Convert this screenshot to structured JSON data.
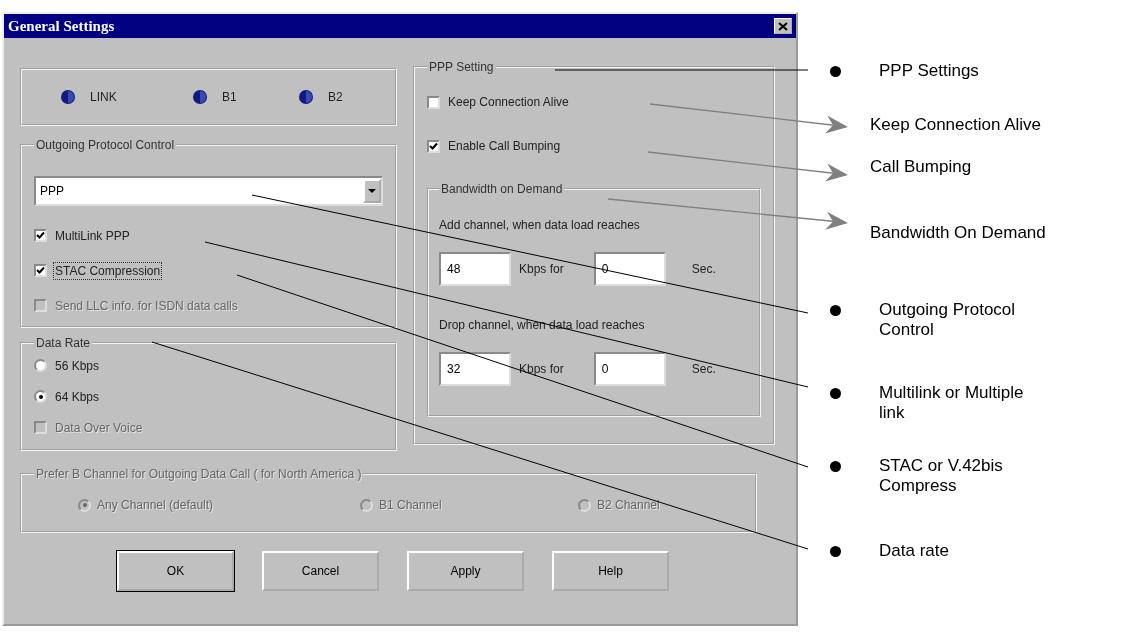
{
  "dialog": {
    "title": "General Settings",
    "indicators": [
      {
        "label": "LINK"
      },
      {
        "label": "B1"
      },
      {
        "label": "B2"
      }
    ],
    "outgoing_protocol_control": {
      "title": "Outgoing Protocol Control",
      "protocol": "PPP",
      "options": [
        {
          "label": "MultiLink PPP",
          "checked": true,
          "disabled": false,
          "focused": false
        },
        {
          "label": "STAC Compression",
          "checked": true,
          "disabled": false,
          "focused": true
        },
        {
          "label": "Send LLC info. for ISDN data calls",
          "checked": false,
          "disabled": true,
          "focused": false
        }
      ]
    },
    "data_rate": {
      "title": "Data Rate",
      "options": [
        {
          "kind": "radio",
          "label": "56 Kbps",
          "selected": false,
          "disabled": false
        },
        {
          "kind": "radio",
          "label": "64 Kbps",
          "selected": true,
          "disabled": false
        },
        {
          "kind": "checkbox",
          "label": "Data Over Voice",
          "checked": false,
          "disabled": true
        }
      ]
    },
    "ppp_setting": {
      "title": "PPP Setting",
      "options": [
        {
          "label": "Keep Connection Alive",
          "checked": false
        },
        {
          "label": "Enable Call Bumping",
          "checked": true
        }
      ],
      "bandwidth_on_demand": {
        "title": "Bandwidth on Demand",
        "rules": [
          {
            "prompt": "Add channel, when data load reaches",
            "rate": "48",
            "rate_unit": "Kbps for",
            "duration": "0",
            "duration_unit": "Sec."
          },
          {
            "prompt": "Drop channel, when data load reaches",
            "rate": "32",
            "rate_unit": "Kbps for",
            "duration": "0",
            "duration_unit": "Sec."
          }
        ]
      }
    },
    "prefer_b_channel": {
      "title": "Prefer B Channel for Outgoing Data Call ( for North America )",
      "disabled": true,
      "options": [
        {
          "label": "Any Channel (default)",
          "selected": true
        },
        {
          "label": "B1 Channel",
          "selected": false
        },
        {
          "label": "B2 Channel",
          "selected": false
        }
      ]
    },
    "buttons": [
      {
        "label": "OK",
        "default": true
      },
      {
        "label": "Cancel",
        "default": false
      },
      {
        "label": "Apply",
        "default": false
      },
      {
        "label": "Help",
        "default": false
      }
    ]
  },
  "annotations": [
    {
      "kind": "bullet",
      "text": "PPP Settings"
    },
    {
      "kind": "arrow",
      "text": "Keep Connection Alive"
    },
    {
      "kind": "arrow",
      "text": "Call Bumping"
    },
    {
      "kind": "arrow",
      "text": "Bandwidth On Demand"
    },
    {
      "kind": "bullet",
      "text": "Outgoing Protocol Control"
    },
    {
      "kind": "bullet",
      "text": "Multilink or Multiple link"
    },
    {
      "kind": "bullet",
      "text": "STAC or V.42bis Compress"
    },
    {
      "kind": "bullet",
      "text": "Data rate"
    }
  ]
}
